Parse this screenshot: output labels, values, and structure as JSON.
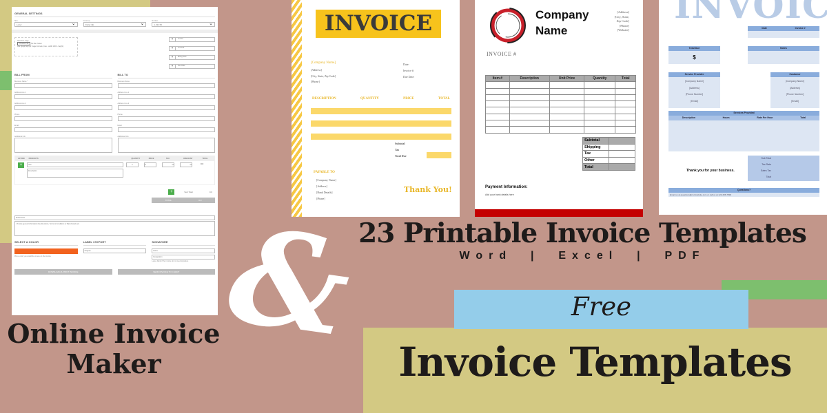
{
  "colors": {
    "background": "#c2968a",
    "olive": "#d3c983",
    "green": "#7dbf6e",
    "sky": "#94cdea",
    "accent_orange": "#f2621e",
    "invoice_yellow": "#f7c31c",
    "invoice_red": "#c40000",
    "invoice_blue": "#89acdc"
  },
  "form": {
    "general_settings": "GENERAL SETTINGS",
    "selects": [
      {
        "label": "Size",
        "value": "Letter"
      },
      {
        "label": "Currency",
        "value": "Dollar ($)"
      },
      {
        "label": "Number",
        "value": "1,234.56"
      }
    ],
    "logo_box": {
      "title": "Add Your Logo",
      "button": "Choose File",
      "note": "No file chosen",
      "hint": "Use .jpeg/.png/.gif image formats (max - width 1000 - height)"
    },
    "side_fields": [
      "Invoice",
      "Invoice#",
      "Billing Date",
      "Due Date"
    ],
    "bill_from": {
      "title": "BILL FROM",
      "fields": [
        "Business Name *",
        "Address Line 1",
        "Address Line 2",
        "Phone",
        "Email",
        "Additional Info"
      ]
    },
    "bill_to": {
      "title": "BILL TO",
      "fields": [
        "Business Name",
        "Address Line 1",
        "Address Line 2",
        "Phone",
        "Email",
        "Additional Info"
      ]
    },
    "items": {
      "headers": [
        "ACTION",
        "PRODUCTS",
        "QUANTITY",
        "PRICE",
        "TAX",
        "DISCOUNT",
        "TOTAL"
      ],
      "item_placeholder": "Item",
      "desc_placeholder": "Description",
      "qty": "1",
      "price": "0",
      "tax": "%",
      "discount": "%",
      "total": "0.0"
    },
    "subtotal_label": "Sub Total",
    "subtotal_value": "0.0",
    "total_label": "TOTAL",
    "total_value": "0.0",
    "extra_notes": "Extra Notes",
    "notes_placeholder": "Provide general information like directions, Terms & Conditions or Bank Details etc",
    "color": {
      "title": "SELECT A COLOR",
      "hint": "Pick a color you would like to use on the invoice"
    },
    "label": {
      "title": "LABEL / EXPORT",
      "value": "Original"
    },
    "signature": {
      "title": "SIGNATURE",
      "fields": [
        "Name",
        "Designation"
      ],
      "hint": "Leave blank if the invoice do not need signature"
    },
    "buttons": [
      "DOWNLOAD & PRINT INVOICE",
      "SEND INVOICE TO CLIENT"
    ]
  },
  "left_title": {
    "line1": "Online Invoice",
    "line2": "Maker"
  },
  "ampersand": "&",
  "yellow_invoice": {
    "title": "INVOICE",
    "company": "[Company Name]",
    "address": [
      "[Address]",
      "[City, State, Zip Code]",
      "[Phone]"
    ],
    "meta": [
      "Date:",
      "Invoice #",
      "Due Date:"
    ],
    "headers": [
      "DESCRIPTION",
      "QUANTITY",
      "PRICE",
      "TOTAL"
    ],
    "totals": [
      "Subtotal",
      "Tax",
      "Total Due"
    ],
    "payable_title": "PAYABLE TO",
    "payable": [
      "[Company Name]",
      "[Address]",
      "[Bank Details]",
      "[Phone]"
    ],
    "thanks": "Thank You!"
  },
  "company_invoice": {
    "name_line1": "Company",
    "name_line2": "Name",
    "contact": [
      "[Address]",
      "[City, State,",
      "Zip Code]",
      "[Phone]",
      "[Website]"
    ],
    "invoice_no": "INVOICE #",
    "headers": [
      "Item #",
      "Description",
      "Unit Price",
      "Quantity",
      "Total"
    ],
    "totals": [
      "Subtotal",
      "Shipping",
      "Tax",
      "Other",
      "Total"
    ],
    "payment_title": "Payment Information:",
    "payment_note": "Add your bank details here"
  },
  "blue_invoice": {
    "title": "INVOICE",
    "date": "Date",
    "invoice_no": "Invoice #",
    "total_due": "Total Due",
    "dollar": "$",
    "notes": "Notes",
    "provider": "Service Provider",
    "customer": "Customer",
    "party_lines": [
      "[Company Name]",
      "[Address]",
      "[Phone Number]",
      "[Email]"
    ],
    "services": "Services Provided",
    "service_headers": [
      "Description",
      "Hours",
      "Rate Per Hour",
      "Total"
    ],
    "totals": [
      "Sub Total",
      "Tax Rate",
      "Sales Tax",
      "Total"
    ],
    "thanks": "Thank you for your business.",
    "questions": "Questions?",
    "contact": "Email us at questions@contractsite.com or call us at 123-456-7890"
  },
  "headline": {
    "title": "23 Printable Invoice Templates",
    "formats": "Word  |  Excel  |  PDF"
  },
  "free": "Free",
  "bottom_title": "Invoice Templates"
}
